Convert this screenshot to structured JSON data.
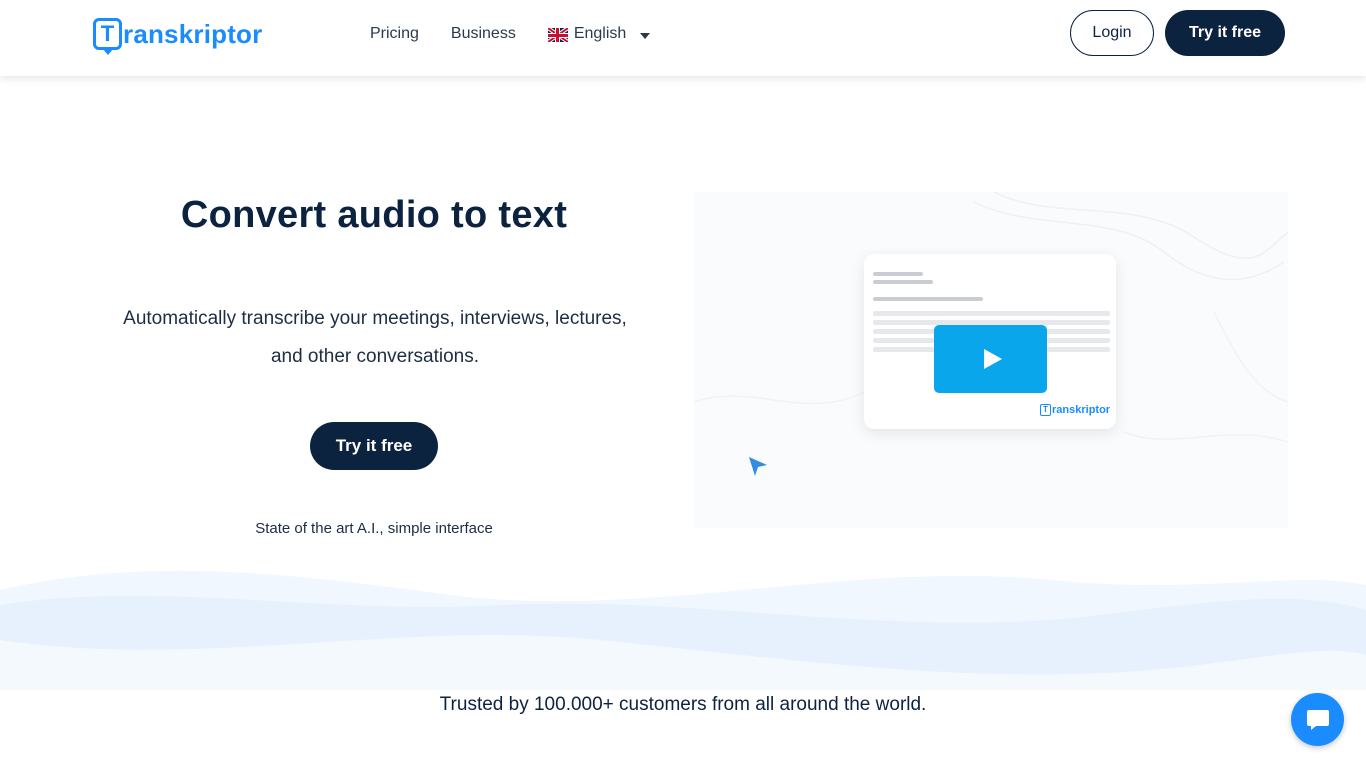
{
  "brand": {
    "logo_letter": "T",
    "logo_text": "ranskriptor",
    "color": "#1a8cff"
  },
  "nav": {
    "items": [
      {
        "label": "Pricing"
      },
      {
        "label": "Business"
      }
    ],
    "language": {
      "label": "English",
      "flag": "uk-flag-icon"
    }
  },
  "header": {
    "login_label": "Login",
    "try_label": "Try it free"
  },
  "hero": {
    "title": "Convert audio to text",
    "subtitle_line1": "Automatically transcribe your meetings, interviews, lectures,",
    "subtitle_line2": "and other conversations.",
    "cta_label": "Try it free",
    "note": "State of the art A.I., simple interface"
  },
  "video_preview": {
    "play_icon": "play-icon",
    "brand_letter": "T",
    "brand_text": "ranskriptor",
    "accent": "#0aa6ec"
  },
  "trusted": {
    "text": "Trusted by 100.000+ customers from all around the world."
  },
  "chat": {
    "icon": "chat-bubble-icon"
  },
  "colors": {
    "navy": "#0c2340",
    "blue": "#1a8cff",
    "wave_light": "#e8f2fd"
  }
}
